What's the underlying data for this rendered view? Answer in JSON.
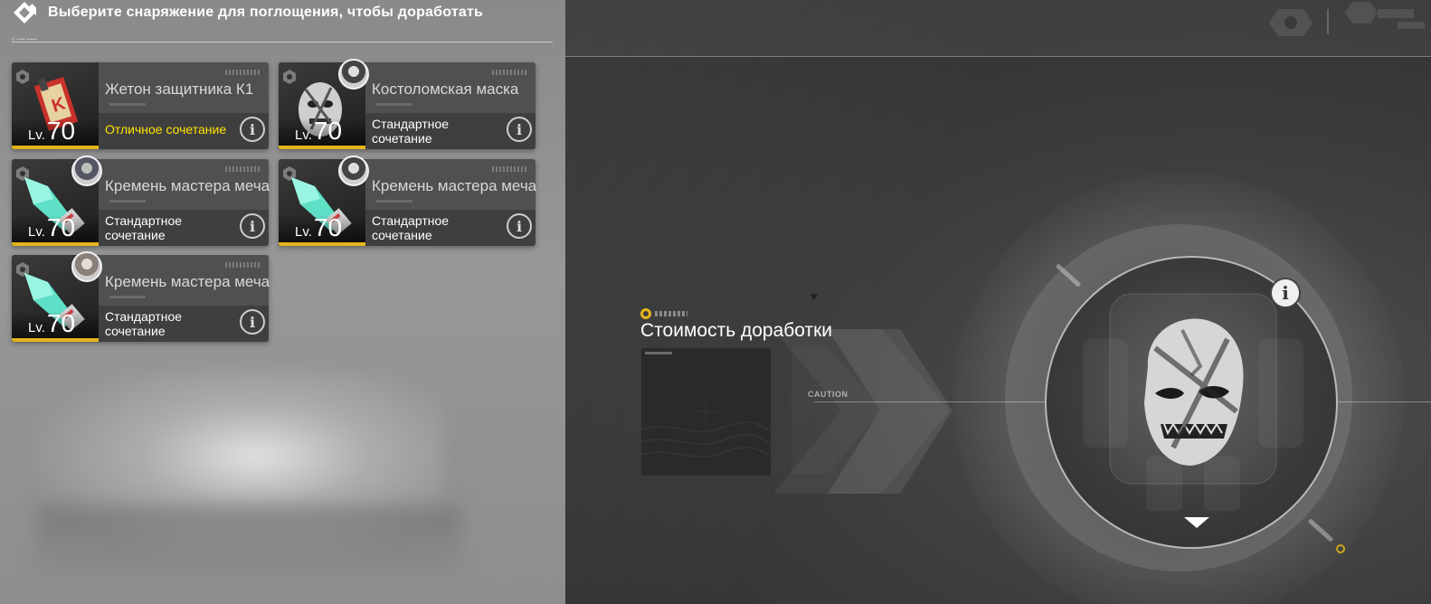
{
  "header": {
    "title": "Выберите снаряжение для поглощения, чтобы доработать"
  },
  "items": [
    {
      "name": "Жетон защитника К1",
      "level_label": "Lv.",
      "level": "70",
      "match": "Отличное сочетание",
      "match_type": "excellent",
      "icon": "defender-token-icon",
      "avatar": false
    },
    {
      "name": "Костоломская маска",
      "level_label": "Lv.",
      "level": "70",
      "match": "Стандартное сочетание",
      "match_type": "standard",
      "icon": "bonebreaker-mask-icon",
      "avatar": true
    },
    {
      "name": "Кремень мастера меча",
      "level_label": "Lv.",
      "level": "70",
      "match": "Стандартное сочетание",
      "match_type": "standard",
      "icon": "flint-icon",
      "avatar": true
    },
    {
      "name": "Кремень мастера меча",
      "level_label": "Lv.",
      "level": "70",
      "match": "Стандартное сочетание",
      "match_type": "standard",
      "icon": "flint-icon",
      "avatar": true
    },
    {
      "name": "Кремень мастера меча",
      "level_label": "Lv.",
      "level": "70",
      "match": "Стандартное сочетание",
      "match_type": "standard",
      "icon": "flint-icon",
      "avatar": true
    }
  ],
  "cost": {
    "title": "Стоимость доработки",
    "caution": "CAUTION"
  },
  "colors": {
    "accent_gold": "#e3b51a",
    "excellent_text": "#ffe300"
  }
}
